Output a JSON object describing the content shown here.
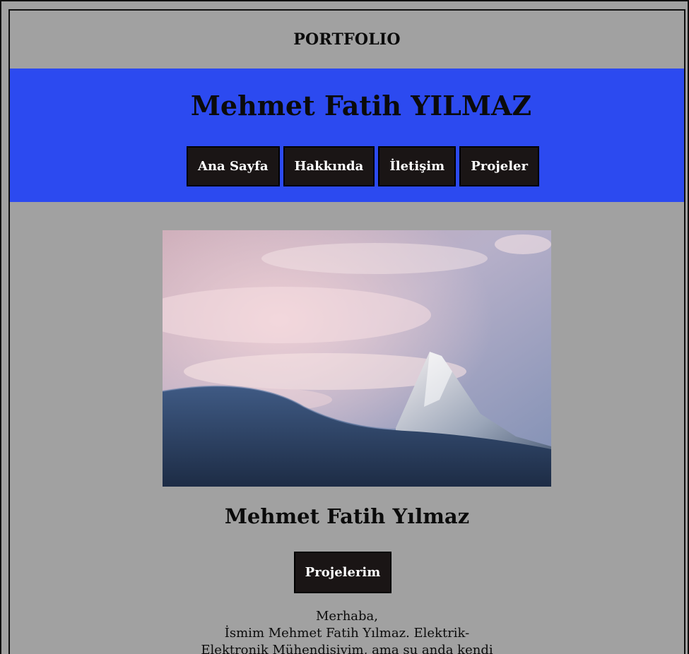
{
  "header": {
    "title": "PORTFOLIO"
  },
  "hero": {
    "name": "Mehmet Fatih YILMAZ",
    "nav": [
      {
        "label": "Ana Sayfa"
      },
      {
        "label": "Hakkında"
      },
      {
        "label": "İletişim"
      },
      {
        "label": "Projeler"
      }
    ]
  },
  "main": {
    "image_alt": "mountain-landscape",
    "name": "Mehmet Fatih Yılmaz",
    "cta_label": "Projelerim",
    "greeting": "Merhaba,",
    "intro_line1": "İsmim Mehmet Fatih Yılmaz. Elektrik-",
    "intro_line2": "Elektronik Mühendisiyim, ama şu anda kendi"
  },
  "colors": {
    "background": "#a1a1a1",
    "hero": "#2c4af0",
    "button": "#1a1515",
    "button_text": "#ffffff"
  }
}
